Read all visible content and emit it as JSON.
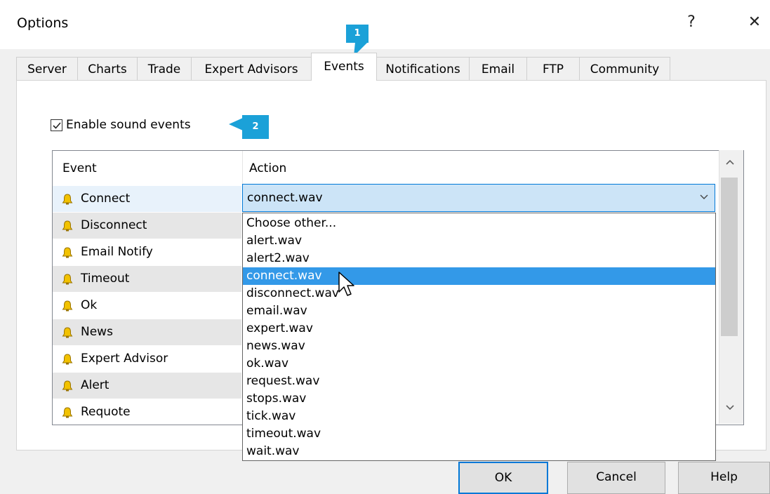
{
  "window": {
    "title": "Options",
    "help_label": "?",
    "close_label": "✕"
  },
  "tabs": [
    {
      "label": "Server"
    },
    {
      "label": "Charts"
    },
    {
      "label": "Trade"
    },
    {
      "label": "Expert Advisors"
    },
    {
      "label": "Events",
      "active": true
    },
    {
      "label": "Notifications"
    },
    {
      "label": "Email"
    },
    {
      "label": "FTP"
    },
    {
      "label": "Community"
    }
  ],
  "callouts": [
    "1",
    "2"
  ],
  "sound": {
    "checkbox_label": "Enable sound events",
    "checked": true
  },
  "list": {
    "headers": {
      "event": "Event",
      "action": "Action"
    },
    "events": [
      "Connect",
      "Disconnect",
      "Email Notify",
      "Timeout",
      "Ok",
      "News",
      "Expert Advisor",
      "Alert",
      "Requote"
    ],
    "row_icon": "bell-icon"
  },
  "combo": {
    "value": "connect.wav",
    "options": [
      "Choose other...",
      "alert.wav",
      "alert2.wav",
      "connect.wav",
      "disconnect.wav",
      "email.wav",
      "expert.wav",
      "news.wav",
      "ok.wav",
      "request.wav",
      "stops.wav",
      "tick.wav",
      "timeout.wav",
      "wait.wav"
    ],
    "selected_index": 3
  },
  "buttons": {
    "ok": "OK",
    "cancel": "Cancel",
    "help": "Help"
  },
  "colors": {
    "accent": "#0078d7",
    "callout": "#1ba1d8",
    "selection": "#3399e8",
    "row_highlight": "#cce4f7"
  }
}
